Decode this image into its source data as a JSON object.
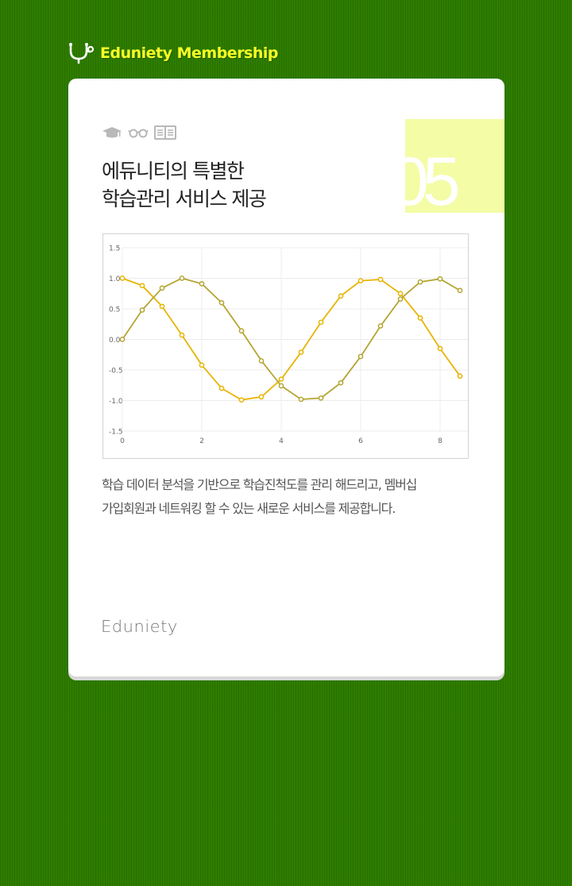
{
  "brand": {
    "name": "Eduniety Membership",
    "icon": "stethoscope-icon",
    "color": "#f5ff24"
  },
  "card": {
    "icons": [
      "graduation-cap-icon",
      "glasses-icon",
      "open-book-icon"
    ],
    "title_line1": "에듀니티의 특별한",
    "title_line2": "학습관리 서비스 제공",
    "number": "05",
    "description_line1": "학습 데이터 분석을 기반으로 학습진척도를 관리 해드리고, 멤버십",
    "description_line2": "가입회원과 네트워킹 할 수 있는 새로운 서비스를 제공합니다.",
    "footer_logo": "Eduniety"
  },
  "colors": {
    "background": "#2e7d00",
    "card": "#ffffff",
    "number_box": "#f4fca6",
    "series_1": "#e8b400",
    "series_2": "#b3a532"
  },
  "chart_data": {
    "type": "line",
    "x": [
      0,
      0.5,
      1,
      1.5,
      2,
      2.5,
      3,
      3.5,
      4,
      4.5,
      5,
      5.5,
      6,
      6.5,
      7,
      7.5,
      8,
      8.5
    ],
    "series": [
      {
        "values": [
          1.0,
          0.88,
          0.54,
          0.07,
          -0.42,
          -0.8,
          -0.99,
          -0.94,
          -0.65,
          -0.21,
          0.28,
          0.71,
          0.96,
          0.98,
          0.75,
          0.35,
          -0.15,
          -0.6
        ],
        "color": "#e8b400"
      },
      {
        "values": [
          0.0,
          0.48,
          0.84,
          1.0,
          0.91,
          0.6,
          0.14,
          -0.35,
          -0.76,
          -0.98,
          -0.96,
          -0.71,
          -0.28,
          0.22,
          0.66,
          0.94,
          0.99,
          0.8
        ],
        "color": "#b3a532"
      }
    ],
    "xlim": [
      0,
      8.7
    ],
    "ylim": [
      -1.5,
      1.5
    ],
    "xticks": [
      "0",
      "2",
      "4",
      "6",
      "8"
    ],
    "yticks": [
      "1.5",
      "1.0",
      "0.5",
      "0.0",
      "-0.5",
      "-1.0",
      "-1.5"
    ],
    "grid": true
  }
}
